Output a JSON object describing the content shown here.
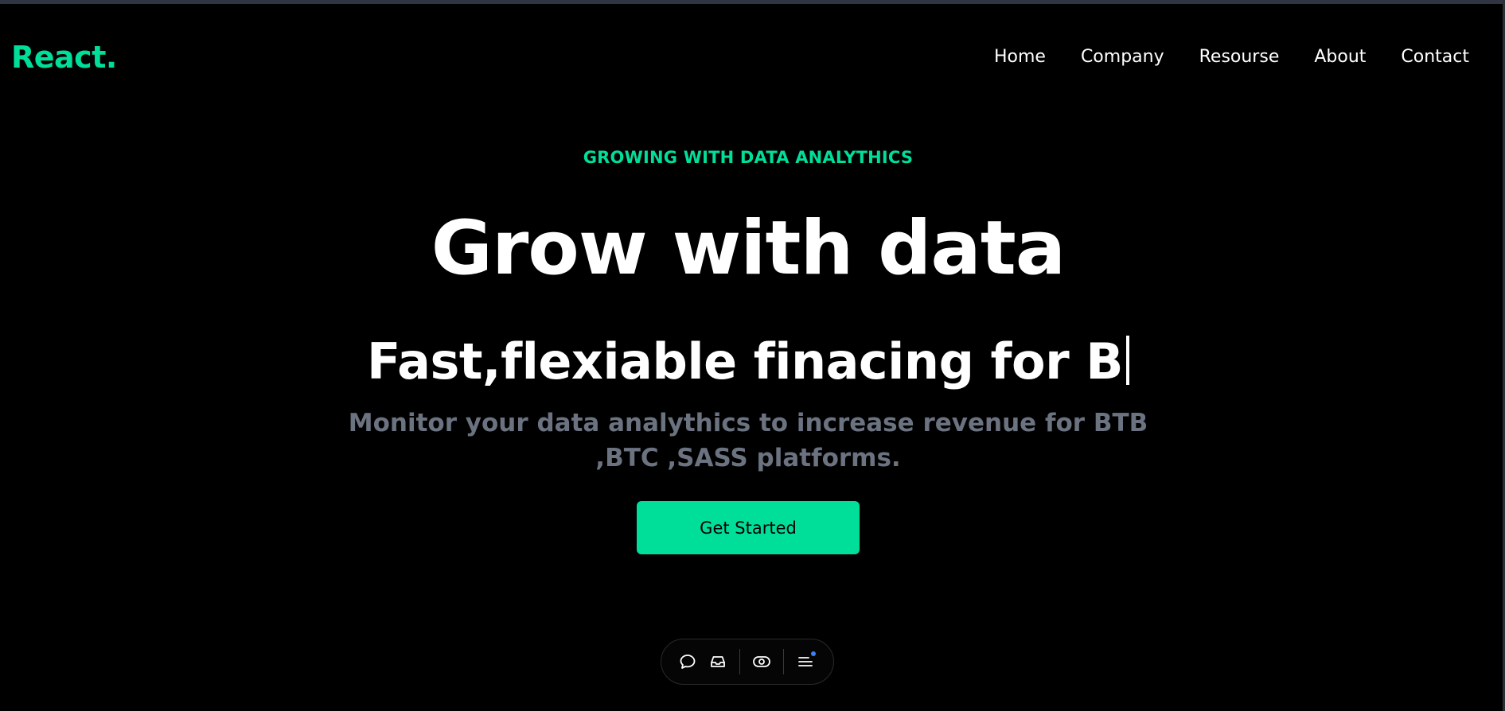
{
  "brand": {
    "logo": "React.",
    "accent_color": "#00df9a"
  },
  "nav": {
    "items": [
      {
        "label": "Home"
      },
      {
        "label": "Company"
      },
      {
        "label": "Resourse"
      },
      {
        "label": "About"
      },
      {
        "label": "Contact"
      }
    ]
  },
  "hero": {
    "eyebrow": "GROWING WITH DATA ANALYTHICS",
    "headline": "Grow with data",
    "typed_text": "Fast,flexiable finacing for B",
    "subtext": "Monitor your data analythics to increase revenue for BTB ,BTC ,SASS platforms.",
    "cta_label": "Get Started"
  },
  "toolbar": {
    "icons": [
      "chat-bubble-icon",
      "inbox-tray-icon",
      "eye-toggle-icon",
      "menu-icon"
    ]
  },
  "colors": {
    "background": "#000000",
    "subtext": "#6b7280",
    "notification_dot": "#3b82f6"
  }
}
